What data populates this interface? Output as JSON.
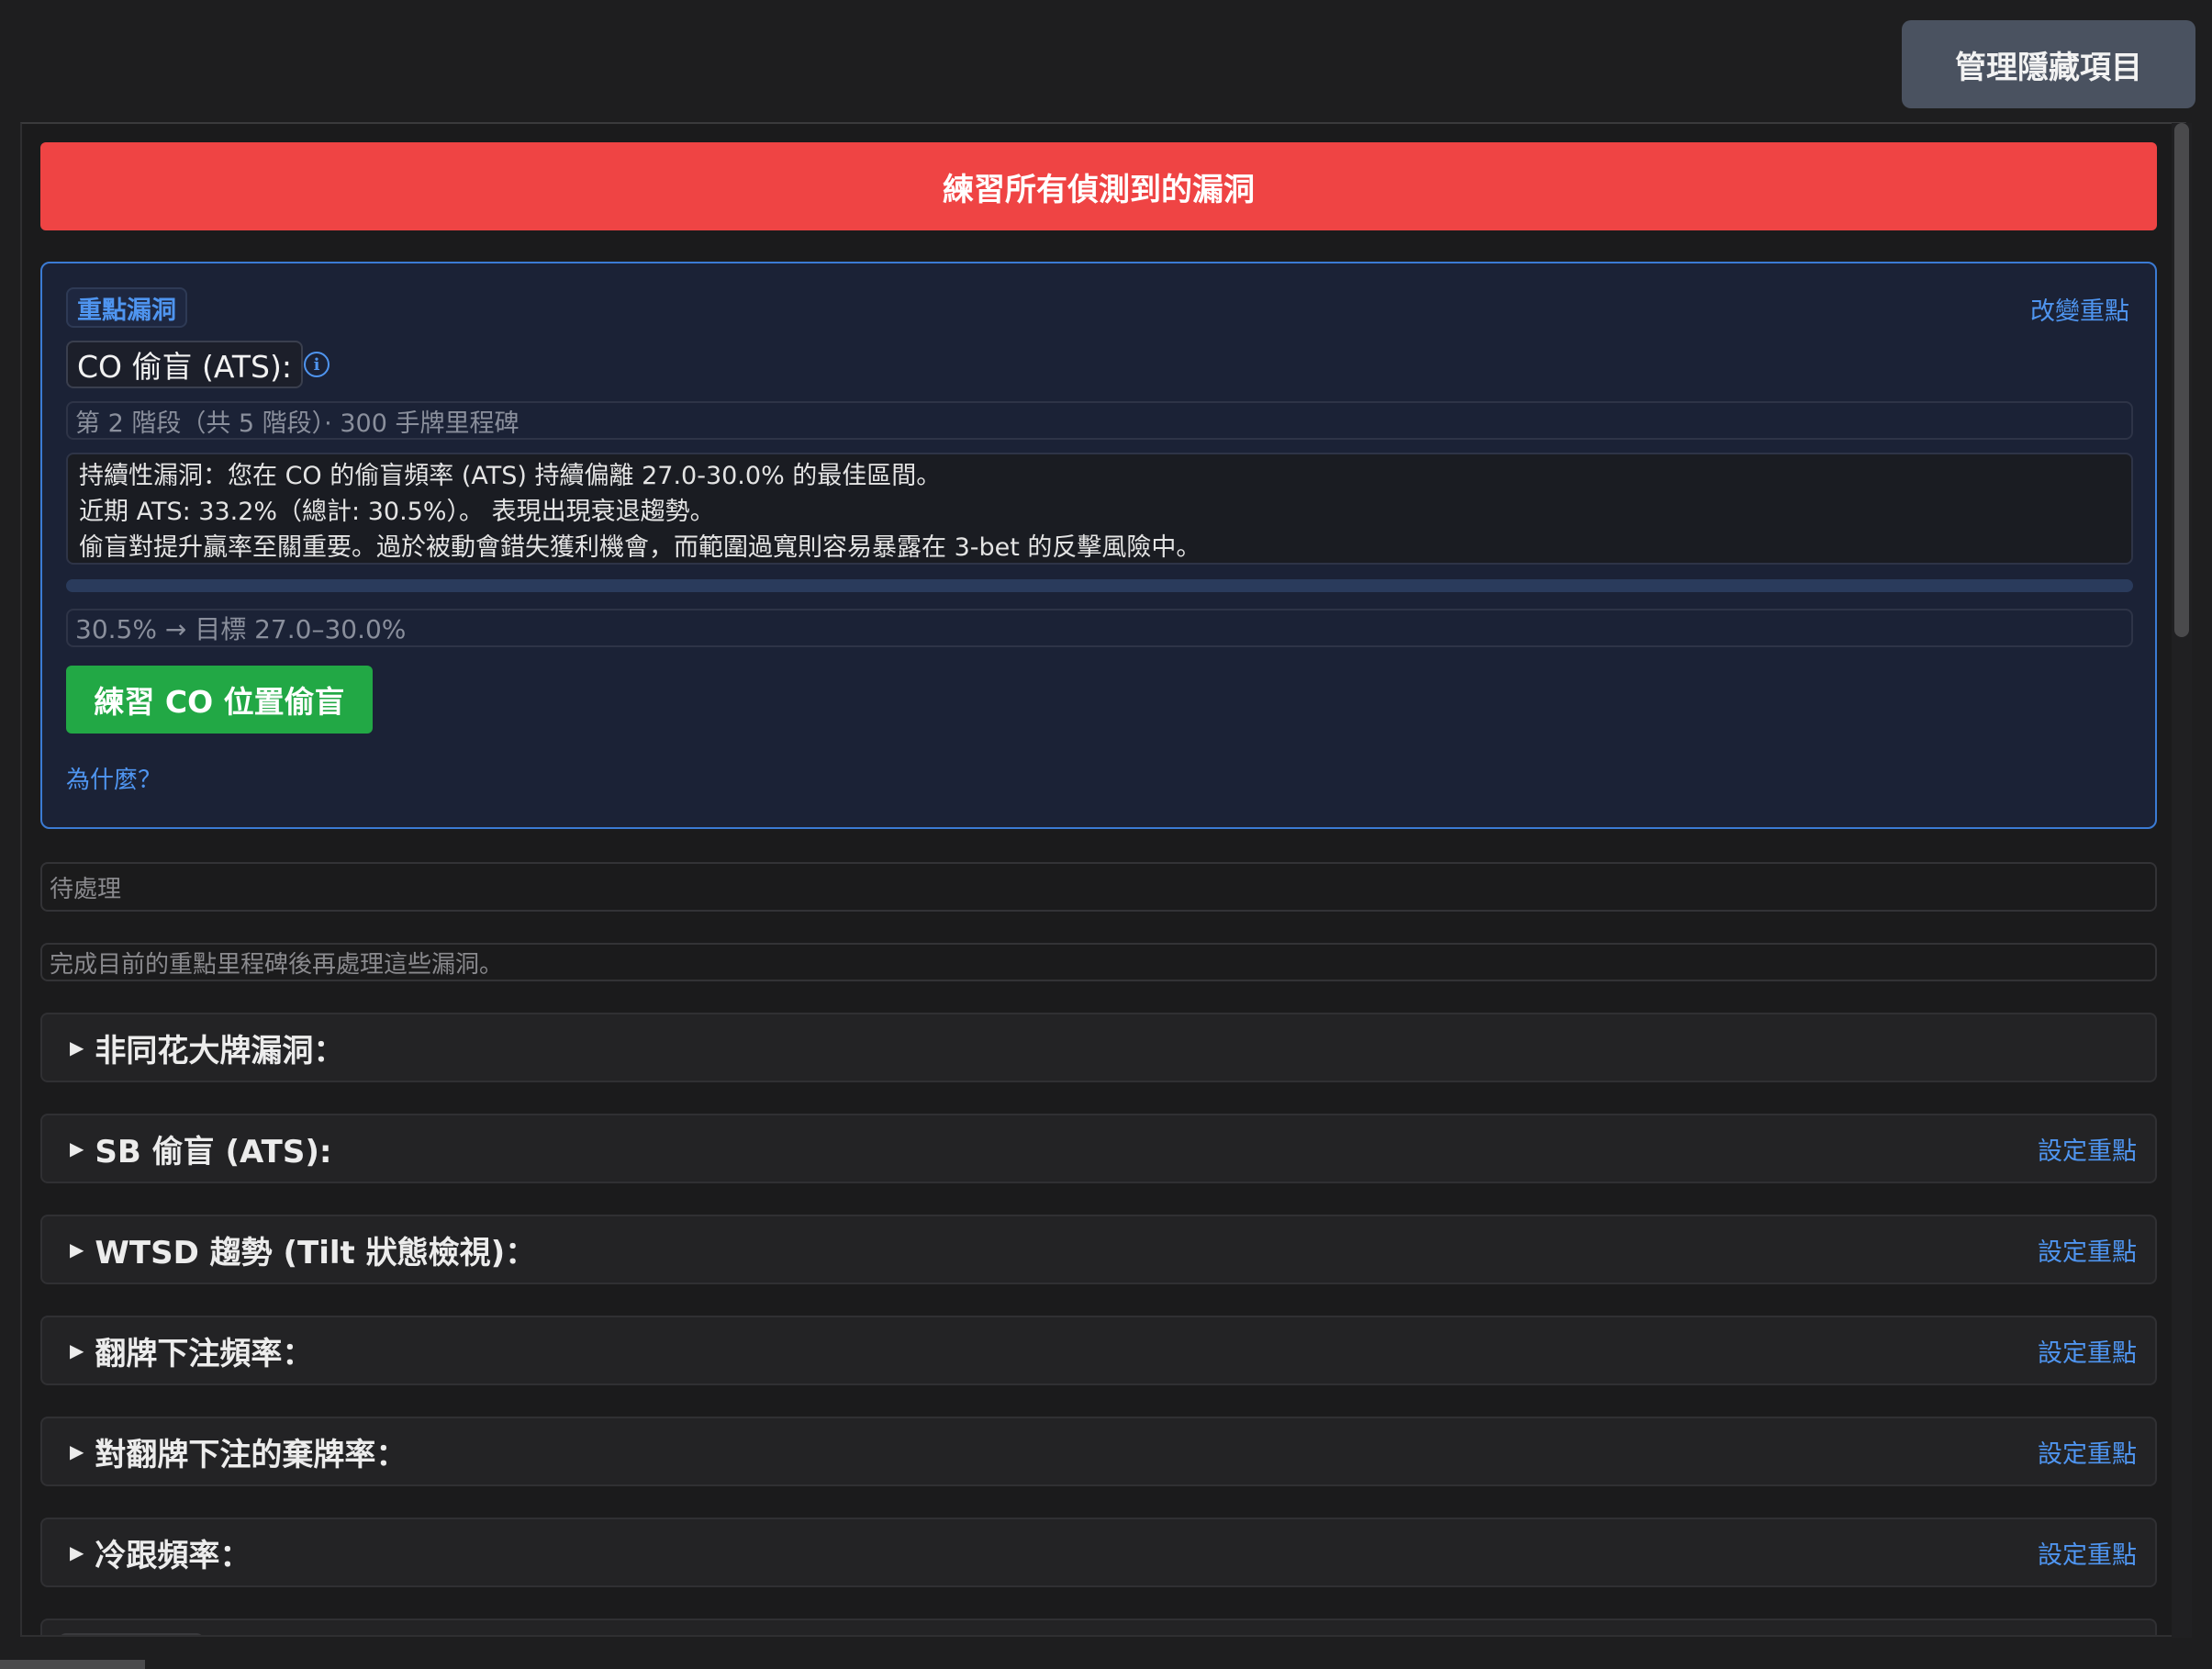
{
  "header": {
    "manage_hidden_label": "管理隱藏項目"
  },
  "practice_all_label": "練習所有偵測到的漏洞",
  "focus": {
    "badge": "重點漏洞",
    "change_label": "改變重點",
    "title": "CO 偷盲 (ATS):",
    "info_icon": "info-circle-icon",
    "stage": "第 2 階段（共 5 階段）· 300 手牌里程碑",
    "description": [
      "持續性漏洞：您在 CO 的偷盲頻率 (ATS) 持續偏離 27.0-30.0% 的最佳區間。",
      "近期 ATS: 33.2%（總計: 30.5%）。 表現出現衰退趨勢。",
      "偷盲對提升贏率至關重要。過於被動會錯失獲利機會，而範圍過寬則容易暴露在 3-bet 的反擊風險中。"
    ],
    "target": "30.5% → 目標 27.0–30.0%",
    "practice_label": "練習 CO 位置偷盲",
    "why_label": "為什麼？"
  },
  "pending": {
    "label": "待處理",
    "note": "完成目前的重點里程碑後再處理這些漏洞。"
  },
  "leaks": [
    {
      "label": "非同花大牌漏洞：",
      "set_focus": ""
    },
    {
      "label": "SB 偷盲 (ATS):",
      "set_focus": "設定重點"
    },
    {
      "label": "WTSD 趨勢 (Tilt 狀態檢視)：",
      "set_focus": "設定重點"
    },
    {
      "label": "翻牌下注頻率：",
      "set_focus": "設定重點"
    },
    {
      "label": "對翻牌下注的棄牌率：",
      "set_focus": "設定重點"
    },
    {
      "label": "冷跟頻率：",
      "set_focus": "設定重點"
    }
  ],
  "colors": {
    "accent_red": "#ef4444",
    "accent_blue": "#4f95f0",
    "accent_green": "#22a845",
    "background": "#1e1e1f"
  }
}
